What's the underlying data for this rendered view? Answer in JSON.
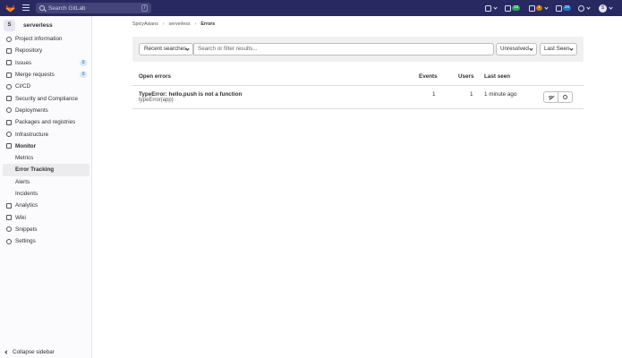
{
  "topbar": {
    "search_placeholder": "Search GitLab",
    "search_shortcut": "/",
    "badges": {
      "merge_requests": "33",
      "issues": "1",
      "todos": "20"
    },
    "avatar_initial": "S",
    "colors": {
      "nav_bg": "#292961",
      "green": "#2da160",
      "orange": "#c17d10",
      "blue": "#1f75cb"
    }
  },
  "sidebar": {
    "project_initial": "S",
    "project_name": "serverless",
    "items": [
      {
        "label": "Project information",
        "icon": "info-icon"
      },
      {
        "label": "Repository",
        "icon": "doc-icon"
      },
      {
        "label": "Issues",
        "icon": "issues-icon",
        "count": "0"
      },
      {
        "label": "Merge requests",
        "icon": "merge-icon",
        "count": "0"
      },
      {
        "label": "CI/CD",
        "icon": "rocket-icon"
      },
      {
        "label": "Security and Compliance",
        "icon": "shield-icon"
      },
      {
        "label": "Deployments",
        "icon": "deploy-icon"
      },
      {
        "label": "Packages and registries",
        "icon": "package-icon"
      },
      {
        "label": "Infrastructure",
        "icon": "cloud-icon"
      },
      {
        "label": "Monitor",
        "icon": "monitor-icon"
      }
    ],
    "monitor_sub": [
      "Metrics",
      "Error Tracking",
      "Alerts",
      "Incidents"
    ],
    "items_after": [
      {
        "label": "Analytics",
        "icon": "chart-icon"
      },
      {
        "label": "Wiki",
        "icon": "book-icon"
      },
      {
        "label": "Snippets",
        "icon": "scissors-icon"
      },
      {
        "label": "Settings",
        "icon": "gear-icon"
      }
    ],
    "collapse_label": "Collapse sidebar"
  },
  "breadcrumb": {
    "group": "SpicyAsians",
    "project": "serverless",
    "current": "Errors",
    "separator": "›"
  },
  "filters": {
    "recent_label": "Recent searches",
    "search_placeholder": "Search or filter results...",
    "status_value": "Unresolved",
    "sort_value": "Last Seen"
  },
  "table": {
    "headers": {
      "errors": "Open errors",
      "events": "Events",
      "users": "Users",
      "last_seen": "Last seen"
    },
    "rows": [
      {
        "title": "TypeError: hello.push is not a function",
        "subtitle": "typeError(app)",
        "events": "1",
        "users": "1",
        "last_seen": "1 minute ago"
      }
    ]
  }
}
